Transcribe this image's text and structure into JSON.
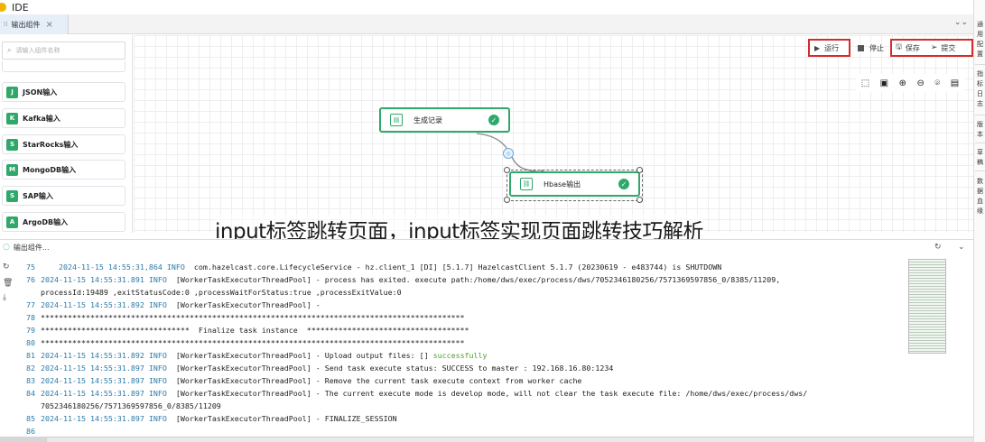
{
  "window": {
    "title": "IDE"
  },
  "tab": {
    "label": "输出组件",
    "icon": "flow-icon"
  },
  "right_panel": [
    {
      "label": "通用配置"
    },
    {
      "label": "指标日志"
    },
    {
      "label": "版本"
    },
    {
      "label": "草稿"
    },
    {
      "label": "数据血缘"
    }
  ],
  "sidebar": {
    "search_placeholder": "请输入组件名称",
    "items": [
      {
        "label": "JSON输入",
        "icon": "json-icon",
        "glyph": "J"
      },
      {
        "label": "Kafka输入",
        "icon": "kafka-icon",
        "glyph": "K"
      },
      {
        "label": "StarRocks输入",
        "icon": "starrocks-icon",
        "glyph": "S"
      },
      {
        "label": "MongoDB输入",
        "icon": "mongodb-icon",
        "glyph": "M"
      },
      {
        "label": "SAP输入",
        "icon": "sap-icon",
        "glyph": "S"
      },
      {
        "label": "ArgoDB输入",
        "icon": "argodb-icon",
        "glyph": "A"
      }
    ]
  },
  "toolbar": {
    "run_label": "运行",
    "stop_label": "停止",
    "save_label": "保存",
    "submit_label": "提交"
  },
  "canvas": {
    "nodes": [
      {
        "label": "生成记录",
        "icon": "records-icon",
        "status": "success"
      },
      {
        "label": "Hbase输出",
        "icon": "hbase-icon",
        "status": "success"
      }
    ]
  },
  "watermark": "input标签跳转页面，input标签实现页面跳转技巧解析",
  "log_panel": {
    "title": "输出组件...",
    "lines": [
      {
        "num": "75",
        "ts": "    2024-11-15 14:55:31,864",
        "level": "INFO",
        "msg": "  com.hazelcast.core.LifecycleService - hz.client_1 [DI] [5.1.7] HazelcastClient 5.1.7 (20230619 - e483744) is SHUTDOWN"
      },
      {
        "num": "76",
        "ts": "2024-11-15 14:55:31.891",
        "level": "INFO",
        "msg": "  [WorkerTaskExecutorThreadPool] - process has exited. execute path:/home/dws/exec/process/dws/7052346180256/7571369597856_0/8385/11209,"
      },
      {
        "num": "",
        "ts": "",
        "level": "",
        "msg": "processId:19489 ,exitStatusCode:0 ,processWaitForStatus:true ,processExitValue:0"
      },
      {
        "num": "77",
        "ts": "2024-11-15 14:55:31.892",
        "level": "INFO",
        "msg": "  [WorkerTaskExecutorThreadPool] -"
      },
      {
        "num": "78",
        "ts": "",
        "level": "",
        "msg": "**********************************************************************************************"
      },
      {
        "num": "79",
        "ts": "",
        "level": "",
        "msg": "*********************************  Finalize task instance  ************************************"
      },
      {
        "num": "80",
        "ts": "",
        "level": "",
        "msg": "**********************************************************************************************"
      },
      {
        "num": "81",
        "ts": "2024-11-15 14:55:31.892",
        "level": "INFO",
        "msg": "  [WorkerTaskExecutorThreadPool] - Upload output files: [] ",
        "ok": "successfully"
      },
      {
        "num": "82",
        "ts": "2024-11-15 14:55:31.897",
        "level": "INFO",
        "msg": "  [WorkerTaskExecutorThreadPool] - Send task execute status: SUCCESS to master : 192.168.16.80:1234"
      },
      {
        "num": "83",
        "ts": "2024-11-15 14:55:31.897",
        "level": "INFO",
        "msg": "  [WorkerTaskExecutorThreadPool] - Remove the current task execute context from worker cache"
      },
      {
        "num": "84",
        "ts": "2024-11-15 14:55:31.897",
        "level": "INFO",
        "msg": "  [WorkerTaskExecutorThreadPool] - The current execute mode is develop mode, will not clear the task execute file: /home/dws/exec/process/dws/"
      },
      {
        "num": "",
        "ts": "",
        "level": "",
        "msg": "7052346180256/7571369597856_0/8385/11209"
      },
      {
        "num": "85",
        "ts": "2024-11-15 14:55:31.897",
        "level": "INFO",
        "msg": "  [WorkerTaskExecutorThreadPool] - FINALIZE_SESSION"
      },
      {
        "num": "86",
        "ts": "",
        "level": "",
        "msg": ""
      }
    ]
  },
  "colors": {
    "accent": "#2fa86a",
    "highlight_border": "#d62b2b"
  }
}
